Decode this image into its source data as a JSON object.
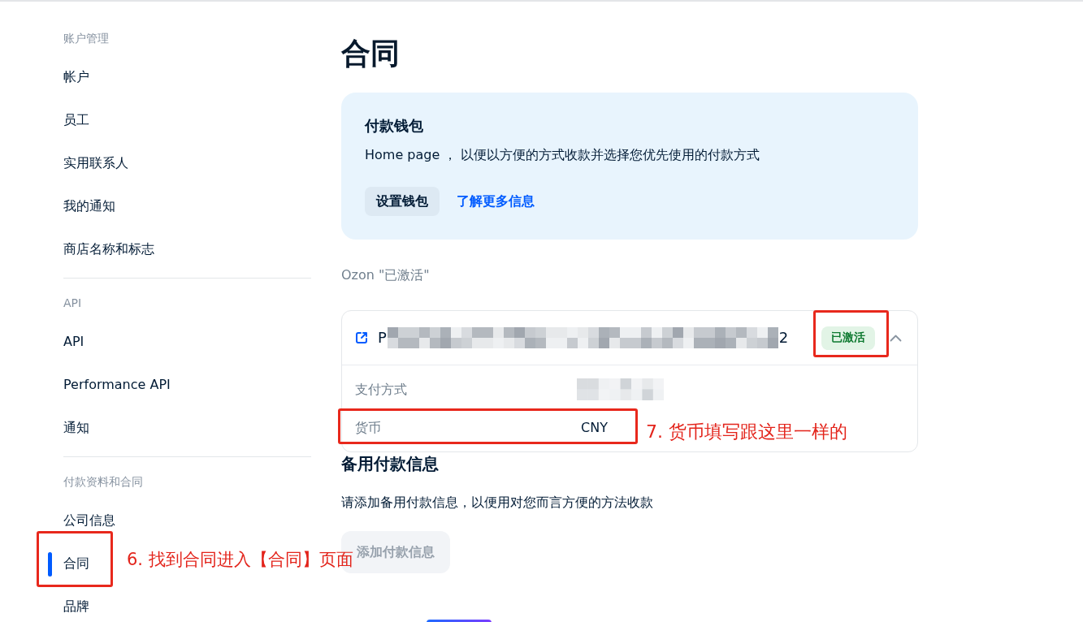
{
  "sidebar": {
    "sections": [
      {
        "heading": "账户管理",
        "items": [
          {
            "label": "帐户",
            "selected": false,
            "highlighted": false
          },
          {
            "label": "员工",
            "selected": false,
            "highlighted": false
          },
          {
            "label": "实用联系人",
            "selected": false,
            "highlighted": false
          },
          {
            "label": "我的通知",
            "selected": false,
            "highlighted": false
          },
          {
            "label": "商店名称和标志",
            "selected": false,
            "highlighted": false
          }
        ]
      },
      {
        "heading": "API",
        "items": [
          {
            "label": "API",
            "selected": false,
            "highlighted": false
          },
          {
            "label": "Performance API",
            "selected": false,
            "highlighted": false
          },
          {
            "label": "通知",
            "selected": false,
            "highlighted": false
          }
        ]
      },
      {
        "heading": "付款资料和合同",
        "items": [
          {
            "label": "公司信息",
            "selected": false,
            "highlighted": false
          },
          {
            "label": "合同",
            "selected": true,
            "highlighted": true,
            "note": "6. 找到合同进入【合同】页面"
          },
          {
            "label": "品牌",
            "selected": false,
            "highlighted": false
          }
        ]
      }
    ]
  },
  "page_title": "合同",
  "wallet_card": {
    "title": "付款钱包",
    "description": "Home page ， 以便以方便的方式收款并选择您优先使用的付款方式",
    "setup_button": "设置钱包",
    "learn_more_link": "了解更多信息"
  },
  "contracts": {
    "heading": "Ozon \"已激活\"",
    "items": [
      {
        "title_start": "P",
        "title_redacted": true,
        "title_end": "2",
        "status": "已激活",
        "status_highlighted": true,
        "expanded": true,
        "fields": [
          {
            "label": "支付方式",
            "redacted": true,
            "highlighted": false
          },
          {
            "label": "货币",
            "value": "CNY",
            "redacted": false,
            "highlighted": true,
            "note": "7. 货币填写跟这里一样的"
          }
        ]
      }
    ]
  },
  "backup_payment": {
    "title": "备用付款信息",
    "description": "请添加备用付款信息，以便用对您而言方便的方法收款",
    "add_button": {
      "label": "添加付款信息",
      "disabled": true
    }
  }
}
